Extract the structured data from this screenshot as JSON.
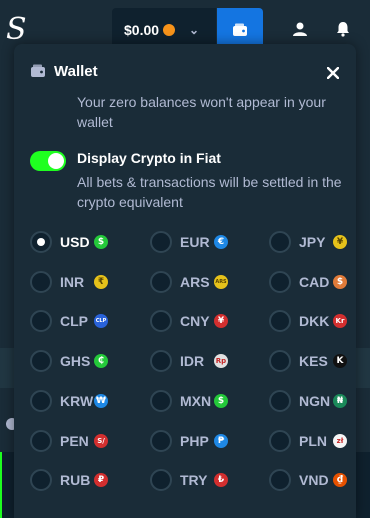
{
  "topbar": {
    "logo": "S",
    "balance": "$0.00",
    "balance_coin_color": "#f7931a",
    "wallet_button_color": "#1475e1"
  },
  "modal": {
    "title": "Wallet",
    "zero_balance_text": "Your zero balances won't appear in your wallet",
    "toggle_label": "Display Crypto in Fiat",
    "toggle_on": true,
    "toggle_color": "#1fff20",
    "toggle_desc": "All bets & transactions will be settled in the crypto equivalent"
  },
  "currencies": [
    {
      "code": "USD",
      "symbol": "$",
      "color": "#24c93a",
      "selected": true
    },
    {
      "code": "EUR",
      "symbol": "€",
      "color": "#1e88e5",
      "selected": false
    },
    {
      "code": "JPY",
      "symbol": "¥",
      "color": "#e6c21a",
      "selected": false
    },
    {
      "code": "INR",
      "symbol": "₹",
      "color": "#e6c21a",
      "selected": false
    },
    {
      "code": "ARS",
      "symbol": "ARS",
      "color": "#e6c21a",
      "selected": false
    },
    {
      "code": "CAD",
      "symbol": "$",
      "color": "#e07b39",
      "selected": false
    },
    {
      "code": "CLP",
      "symbol": "CLP",
      "color": "#2962d9",
      "selected": false
    },
    {
      "code": "CNY",
      "symbol": "¥",
      "color": "#d32f2f",
      "selected": false
    },
    {
      "code": "DKK",
      "symbol": "Kr",
      "color": "#d32f2f",
      "selected": false
    },
    {
      "code": "GHS",
      "symbol": "₵",
      "color": "#24c93a",
      "selected": false
    },
    {
      "code": "IDR",
      "symbol": "Rp",
      "color": "#e0e0e0",
      "selected": false
    },
    {
      "code": "KES",
      "symbol": "K",
      "color": "#111111",
      "selected": false
    },
    {
      "code": "KRW",
      "symbol": "₩",
      "color": "#1e88e5",
      "selected": false
    },
    {
      "code": "MXN",
      "symbol": "$",
      "color": "#24c93a",
      "selected": false
    },
    {
      "code": "NGN",
      "symbol": "₦",
      "color": "#1b8a5a",
      "selected": false
    },
    {
      "code": "PEN",
      "symbol": "S/",
      "color": "#d32f2f",
      "selected": false
    },
    {
      "code": "PHP",
      "symbol": "₱",
      "color": "#1e88e5",
      "selected": false
    },
    {
      "code": "PLN",
      "symbol": "zł",
      "color": "#f5f5f5",
      "selected": false
    },
    {
      "code": "RUB",
      "symbol": "₽",
      "color": "#d32f2f",
      "selected": false
    },
    {
      "code": "TRY",
      "symbol": "₺",
      "color": "#d32f2f",
      "selected": false
    },
    {
      "code": "VND",
      "symbol": "₫",
      "color": "#e65100",
      "selected": false
    }
  ]
}
